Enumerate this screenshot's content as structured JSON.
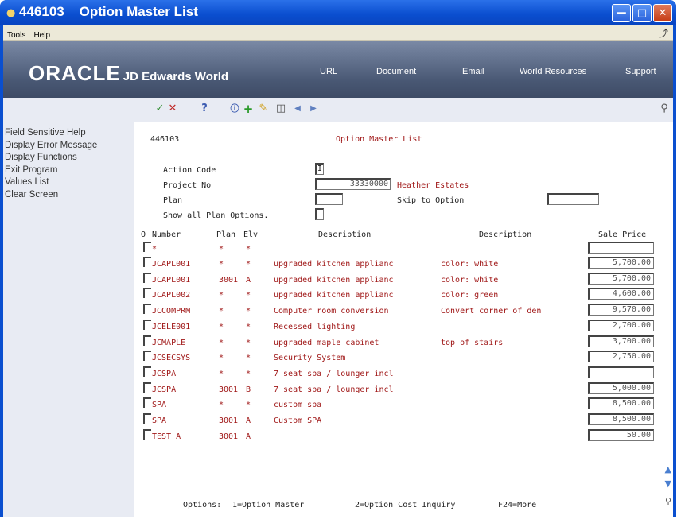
{
  "window": {
    "title": "446103    Option Master List",
    "controls": [
      "minimize",
      "maximize",
      "close"
    ]
  },
  "menubar": {
    "items": [
      "Tools",
      "Help"
    ]
  },
  "banner": {
    "logo_oracle": "ORACLE",
    "logo_product": "JD Edwards World",
    "links": [
      "URL",
      "Document",
      "Email",
      "World Resources",
      "Support"
    ]
  },
  "sidebar": {
    "items": [
      "Field Sensitive Help",
      "Display Error Message",
      "Display Functions",
      "Exit Program",
      "Values List",
      "Clear Screen"
    ]
  },
  "toolbar": {
    "icons": [
      "check-icon",
      "cancel-icon",
      "help-icon",
      "info-icon",
      "add-icon",
      "edit-icon",
      "delete-icon",
      "prev-page-icon",
      "next-page-icon",
      "search-icon"
    ]
  },
  "form": {
    "program_id": "446103",
    "title": "Option Master List",
    "labels": {
      "action_code": "Action Code",
      "project_no": "Project No",
      "plan": "Plan",
      "skip_to_option": "Skip to Option",
      "show_all": "Show all Plan Options."
    },
    "values": {
      "action_code": "I",
      "project_no": "33330000",
      "project_name": "Heather Estates",
      "plan": "",
      "skip_to_option": "",
      "show_all": ""
    }
  },
  "table": {
    "headers": {
      "o": "O",
      "number": "Number",
      "plan": "Plan",
      "elv": "Elv",
      "description1": "Description",
      "description2": "Description",
      "sale_price": "Sale Price"
    },
    "filter_row": {
      "number": "*",
      "plan": "*",
      "elv": "*"
    },
    "rows": [
      {
        "number": "JCAPL001",
        "plan": "*",
        "elv": "*",
        "desc1": "upgraded kitchen applianc",
        "desc2": "color: white",
        "price": "5,700.00"
      },
      {
        "number": "JCAPL001",
        "plan": "3001",
        "elv": "A",
        "desc1": "upgraded kitchen applianc",
        "desc2": "color: white",
        "price": "5,700.00"
      },
      {
        "number": "JCAPL002",
        "plan": "*",
        "elv": "*",
        "desc1": "upgraded kitchen applianc",
        "desc2": "color: green",
        "price": "4,600.00"
      },
      {
        "number": "JCCOMPRM",
        "plan": "*",
        "elv": "*",
        "desc1": "Computer room conversion",
        "desc2": "Convert corner of den",
        "price": "9,570.00"
      },
      {
        "number": "JCELE001",
        "plan": "*",
        "elv": "*",
        "desc1": "Recessed lighting",
        "desc2": "",
        "price": "2,700.00"
      },
      {
        "number": "JCMAPLE",
        "plan": "*",
        "elv": "*",
        "desc1": "upgraded maple cabinet",
        "desc2": "top of stairs",
        "price": "3,700.00"
      },
      {
        "number": "JCSECSYS",
        "plan": "*",
        "elv": "*",
        "desc1": "Security System",
        "desc2": "",
        "price": "2,750.00"
      },
      {
        "number": "JCSPA",
        "plan": "*",
        "elv": "*",
        "desc1": "7 seat spa / lounger incl",
        "desc2": "",
        "price": ""
      },
      {
        "number": "JCSPA",
        "plan": "3001",
        "elv": "B",
        "desc1": "7 seat spa / lounger incl",
        "desc2": "",
        "price": "5,000.00"
      },
      {
        "number": "SPA",
        "plan": "*",
        "elv": "*",
        "desc1": "custom spa",
        "desc2": "",
        "price": "8,500.00"
      },
      {
        "number": "SPA",
        "plan": "3001",
        "elv": "A",
        "desc1": "Custom SPA",
        "desc2": "",
        "price": "8,500.00"
      },
      {
        "number": "TEST A",
        "plan": "3001",
        "elv": "A",
        "desc1": "",
        "desc2": "",
        "price": "50.00"
      }
    ]
  },
  "footer": {
    "options_label": "Options:",
    "opt1": "1=Option Master",
    "opt2": "2=Option Cost Inquiry",
    "opt3": "F24=More"
  },
  "colors": {
    "title_bar": "#0b4fd0",
    "banner": "#495874",
    "sidebar_bg": "#e8ebf3",
    "data_text": "#a01818"
  }
}
